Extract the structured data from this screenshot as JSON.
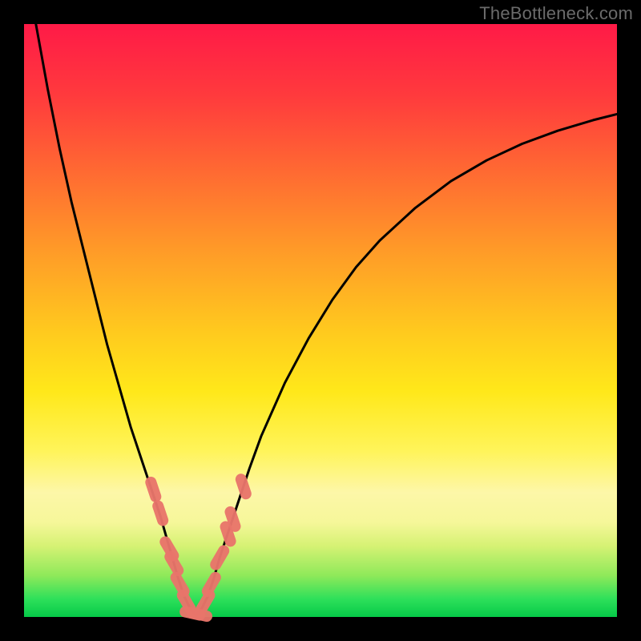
{
  "watermark": "TheBottleneck.com",
  "colors": {
    "gradient_top": "#ff1a47",
    "gradient_bottom": "#06c948",
    "curve_stroke": "#000000",
    "marker_fill": "#e9756b",
    "marker_stroke": "#e9756b"
  },
  "chart_data": {
    "type": "line",
    "title": "",
    "xlabel": "",
    "ylabel": "",
    "xlim": [
      0,
      100
    ],
    "ylim": [
      0,
      100
    ],
    "grid": false,
    "legend": false,
    "series": [
      {
        "name": "left-curve",
        "x": [
          2.0,
          4.0,
          6.0,
          8.0,
          10.0,
          12.0,
          14.0,
          16.0,
          18.0,
          19.0,
          20.0,
          21.0,
          22.0,
          23.0,
          24.0,
          25.0,
          26.0,
          27.0,
          28.0,
          29.0
        ],
        "y": [
          100.0,
          89.0,
          79.0,
          70.0,
          62.0,
          54.0,
          46.0,
          39.0,
          32.0,
          29.0,
          26.0,
          23.0,
          20.0,
          17.0,
          13.5,
          10.0,
          6.5,
          3.5,
          1.5,
          0.2
        ]
      },
      {
        "name": "right-curve",
        "x": [
          29.0,
          30.0,
          31.0,
          32.0,
          33.0,
          34.0,
          36.0,
          38.0,
          40.0,
          44.0,
          48.0,
          52.0,
          56.0,
          60.0,
          66.0,
          72.0,
          78.0,
          84.0,
          90.0,
          96.0,
          100.0
        ],
        "y": [
          0.2,
          1.5,
          3.5,
          6.5,
          10.0,
          13.0,
          19.0,
          25.0,
          30.5,
          39.5,
          47.0,
          53.5,
          59.0,
          63.5,
          69.0,
          73.5,
          77.0,
          79.8,
          82.0,
          83.8,
          84.8
        ]
      }
    ],
    "markers": {
      "name": "highlighted-points",
      "shape": "pill",
      "points": [
        {
          "x": 21.8,
          "y": 21.5,
          "orient": "v"
        },
        {
          "x": 23.0,
          "y": 17.5,
          "orient": "v"
        },
        {
          "x": 24.5,
          "y": 11.5,
          "orient": "d"
        },
        {
          "x": 25.3,
          "y": 9.0,
          "orient": "d"
        },
        {
          "x": 26.3,
          "y": 5.5,
          "orient": "d"
        },
        {
          "x": 27.4,
          "y": 2.5,
          "orient": "d"
        },
        {
          "x": 28.4,
          "y": 0.6,
          "orient": "h"
        },
        {
          "x": 29.6,
          "y": 0.4,
          "orient": "h"
        },
        {
          "x": 30.6,
          "y": 2.5,
          "orient": "d2"
        },
        {
          "x": 31.6,
          "y": 5.5,
          "orient": "d2"
        },
        {
          "x": 33.0,
          "y": 10.0,
          "orient": "d2"
        },
        {
          "x": 34.4,
          "y": 14.0,
          "orient": "v"
        },
        {
          "x": 35.2,
          "y": 16.5,
          "orient": "v"
        },
        {
          "x": 37.0,
          "y": 22.0,
          "orient": "v"
        }
      ]
    }
  }
}
